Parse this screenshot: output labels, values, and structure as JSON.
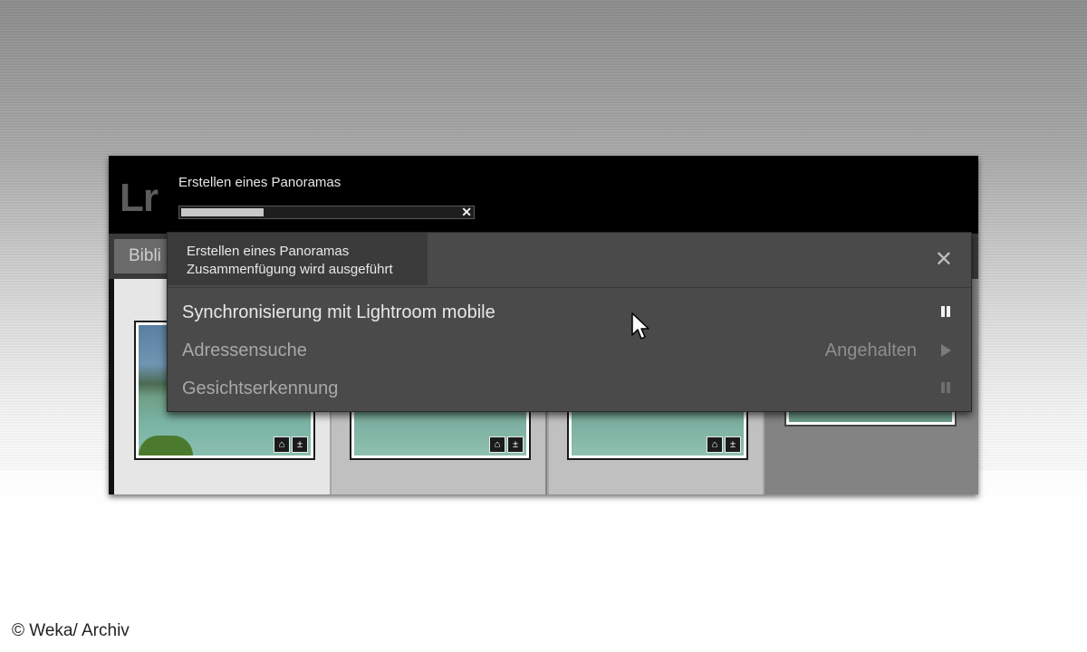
{
  "app": {
    "logo": "Lr",
    "task_title": "Erstellen eines Panoramas",
    "progress_percent": 30,
    "module_tab": "Bibli"
  },
  "activity_center": {
    "header_title": "Erstellen eines Panoramas",
    "header_subtitle": "Zusammenfügung wird ausgeführt",
    "rows": [
      {
        "label": "Synchronisierung mit Lightroom mobile",
        "status": "",
        "control": "pause",
        "active": true
      },
      {
        "label": "Adressensuche",
        "status": "Angehalten",
        "control": "play",
        "active": false
      },
      {
        "label": "Gesichtserkennung",
        "status": "",
        "control": "pause",
        "active": false
      }
    ]
  },
  "watermark": "© Weka/ Archiv",
  "colors": {
    "window_bg": "#000000",
    "panel_bg": "#4a4a4a",
    "active_text": "#e8e8e8",
    "inactive_text": "#a8a8a8"
  }
}
